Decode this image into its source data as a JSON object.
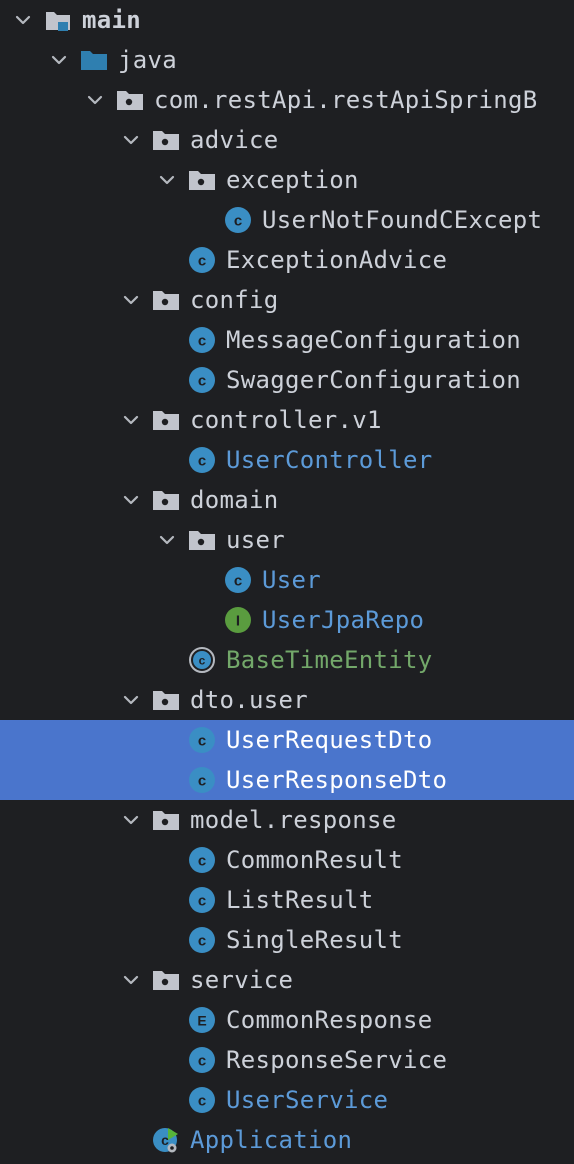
{
  "colors": {
    "background": "#1e1f22",
    "selection": "#4a75cc",
    "text_default": "#cdd1d9",
    "text_modified": "#5c9ad8",
    "text_added": "#73a86a",
    "class_icon": "#3a8ec4",
    "interface_icon": "#5a9c3f",
    "folder": "#c1c4cc",
    "source_folder": "#2f7fb0"
  },
  "tree": [
    {
      "depth": 0,
      "label": "main",
      "icon": "folder-main-icon",
      "expanded": true,
      "bold": true
    },
    {
      "depth": 1,
      "label": "java",
      "icon": "source-folder-icon",
      "expanded": true
    },
    {
      "depth": 2,
      "label": "com.restApi.restApiSpringB",
      "icon": "package-icon",
      "expanded": true
    },
    {
      "depth": 3,
      "label": "advice",
      "icon": "package-icon",
      "expanded": true
    },
    {
      "depth": 4,
      "label": "exception",
      "icon": "package-icon",
      "expanded": true
    },
    {
      "depth": 5,
      "label": "UserNotFoundCExcept",
      "icon": "class-icon"
    },
    {
      "depth": 4,
      "label": "ExceptionAdvice",
      "icon": "class-icon"
    },
    {
      "depth": 3,
      "label": "config",
      "icon": "package-icon",
      "expanded": true
    },
    {
      "depth": 4,
      "label": "MessageConfiguration",
      "icon": "class-icon"
    },
    {
      "depth": 4,
      "label": "SwaggerConfiguration",
      "icon": "class-icon"
    },
    {
      "depth": 3,
      "label": "controller.v1",
      "icon": "package-icon",
      "expanded": true
    },
    {
      "depth": 4,
      "label": "UserController",
      "icon": "class-icon",
      "status": "modified"
    },
    {
      "depth": 3,
      "label": "domain",
      "icon": "package-icon",
      "expanded": true
    },
    {
      "depth": 4,
      "label": "user",
      "icon": "package-icon",
      "expanded": true
    },
    {
      "depth": 5,
      "label": "User",
      "icon": "class-icon",
      "status": "modified"
    },
    {
      "depth": 5,
      "label": "UserJpaRepo",
      "icon": "interface-icon",
      "status": "modified"
    },
    {
      "depth": 4,
      "label": "BaseTimeEntity",
      "icon": "abstract-class-icon",
      "status": "added"
    },
    {
      "depth": 3,
      "label": "dto.user",
      "icon": "package-icon",
      "expanded": true
    },
    {
      "depth": 4,
      "label": "UserRequestDto",
      "icon": "class-icon",
      "selected": true
    },
    {
      "depth": 4,
      "label": "UserResponseDto",
      "icon": "class-icon",
      "selected": true
    },
    {
      "depth": 3,
      "label": "model.response",
      "icon": "package-icon",
      "expanded": true
    },
    {
      "depth": 4,
      "label": "CommonResult",
      "icon": "class-icon"
    },
    {
      "depth": 4,
      "label": "ListResult",
      "icon": "class-icon"
    },
    {
      "depth": 4,
      "label": "SingleResult",
      "icon": "class-icon"
    },
    {
      "depth": 3,
      "label": "service",
      "icon": "package-icon",
      "expanded": true
    },
    {
      "depth": 4,
      "label": "CommonResponse",
      "icon": "enum-icon"
    },
    {
      "depth": 4,
      "label": "ResponseService",
      "icon": "class-icon"
    },
    {
      "depth": 4,
      "label": "UserService",
      "icon": "class-icon",
      "status": "modified"
    },
    {
      "depth": 3,
      "label": "Application",
      "icon": "spring-app-class-icon",
      "status": "modified"
    }
  ]
}
